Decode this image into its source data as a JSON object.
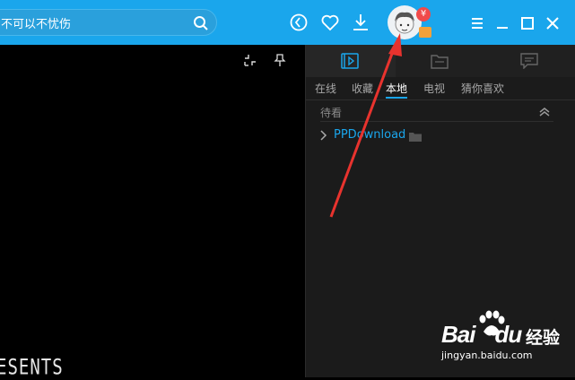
{
  "search": {
    "value": "不可以不忧伤"
  },
  "titlebar_icons": [
    "history-icon",
    "favorite-heart-icon",
    "download-icon",
    "user-avatar",
    "menu-icon",
    "minimize-icon",
    "maximize-icon",
    "close-icon"
  ],
  "badges": {
    "vip": "¥"
  },
  "player": {
    "video_text": "ESENTS"
  },
  "panel": {
    "main_tabs": [
      "playlist-icon",
      "files-icon",
      "comments-icon"
    ],
    "sub_tabs": [
      "在线",
      "收藏",
      "本地",
      "电视",
      "猜你喜欢"
    ],
    "active_sub_tab": "本地",
    "section_title": "待看",
    "folder": {
      "label": "PPDownload"
    }
  },
  "watermark": {
    "brand": "Bai",
    "brand2": "du",
    "product": "经验",
    "url": "jingyan.baidu.com"
  },
  "colors": {
    "titlebar": "#1aa6ec",
    "accent": "#1aa6ec",
    "panel_bg": "#1b1b1b",
    "arrow": "#e8332e"
  }
}
